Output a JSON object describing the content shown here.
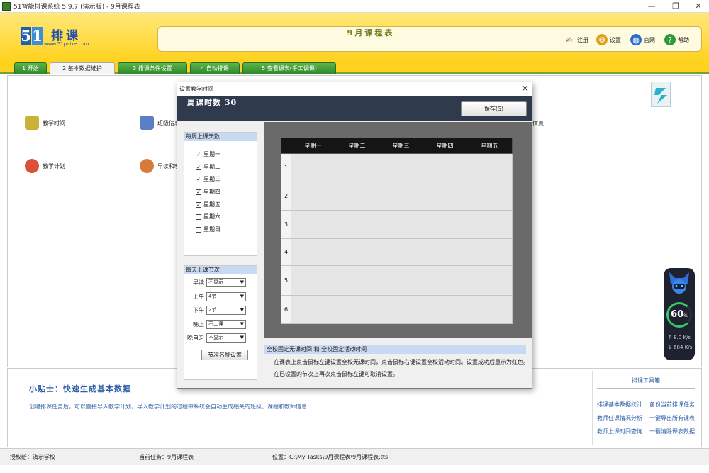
{
  "window": {
    "title": "51智能排课系统 5.9.7 (演示版) - 9月课程表"
  },
  "header": {
    "logo_digits": [
      "5",
      "1"
    ],
    "logo_text": "排课",
    "logo_url": "www.51paike.com",
    "title": "9月课程表",
    "buttons": [
      {
        "label": "注册",
        "icon": "register-icon"
      },
      {
        "label": "设置",
        "icon": "gear-icon"
      },
      {
        "label": "官网",
        "icon": "globe-icon"
      },
      {
        "label": "帮助",
        "icon": "help-icon"
      }
    ]
  },
  "tabs": [
    {
      "label": "1 开始",
      "active": false
    },
    {
      "label": "2 基本数据维护",
      "active": true
    },
    {
      "label": "3 排课条件设置",
      "active": false
    },
    {
      "label": "4 自动排课",
      "active": false
    },
    {
      "label": "5 查看课表(手工调课)",
      "active": false
    }
  ],
  "main": {
    "features": [
      {
        "label": "教学时间"
      },
      {
        "label": "班级信息"
      },
      {
        "label": "信息"
      },
      {
        "label": "教学计划"
      },
      {
        "label": "早读和晚"
      }
    ]
  },
  "tips": {
    "title": "小贴士：快速生成基本数据",
    "text": "创建排课任务后，可以直接导入教学计划，导入教学计划的过程中系统会自动生成相关的班级、课程和教师信息"
  },
  "tools": {
    "title": "排课工具箱",
    "links": [
      "排课基本数据统计",
      "备份当前排课任务",
      "教师任课情况分析",
      "一键导出所有课表",
      "教师上课时间查询",
      "一键清除课表数据"
    ]
  },
  "status": {
    "license": "授权给：演示学校",
    "task": "当前任务：9月课程表",
    "location": "位置：C:\\My Tasks\\9月课程表\\9月课程表.tts"
  },
  "dialog": {
    "title": "设置教学时间",
    "weekly_label": "周课时数 30",
    "save_label": "保存(S)",
    "days_header": "每周上课天数",
    "days": [
      {
        "label": "星期一",
        "checked": true
      },
      {
        "label": "星期二",
        "checked": true
      },
      {
        "label": "星期三",
        "checked": true
      },
      {
        "label": "星期四",
        "checked": true
      },
      {
        "label": "星期五",
        "checked": true
      },
      {
        "label": "星期六",
        "checked": false
      },
      {
        "label": "星期日",
        "checked": false
      }
    ],
    "periods_header": "每天上课节次",
    "periods": [
      {
        "label": "早读",
        "value": "不显示"
      },
      {
        "label": "上午",
        "value": "4节"
      },
      {
        "label": "下午",
        "value": "2节"
      },
      {
        "label": "晚上",
        "value": "不上课"
      },
      {
        "label": "晚自习",
        "value": "不显示"
      }
    ],
    "names_button": "节次名称设置",
    "table": {
      "columns": [
        "星期一",
        "星期二",
        "星期三",
        "星期四",
        "星期五"
      ],
      "rows": [
        "1",
        "2",
        "3",
        "4",
        "5",
        "6"
      ]
    },
    "note_header": "全校固定无课时间 和 全校固定活动时间",
    "note_lines": [
      "在课表上点击鼠标左键设置全校无课时间，点击鼠标右键设置全校活动时间。设置成功后显示为红色。",
      "在已设置的节次上再次点击鼠标左键可取消设置。"
    ]
  },
  "side_widget": {
    "percent": "60",
    "unit": "%",
    "up": "8.0",
    "down": "684",
    "speed_unit": "K/s"
  },
  "colors": {
    "header_yellow": "#ffd21f",
    "tab_green": "#2e8a2a",
    "dialog_head": "#2f3a4d",
    "link_blue": "#2e5fa8"
  }
}
